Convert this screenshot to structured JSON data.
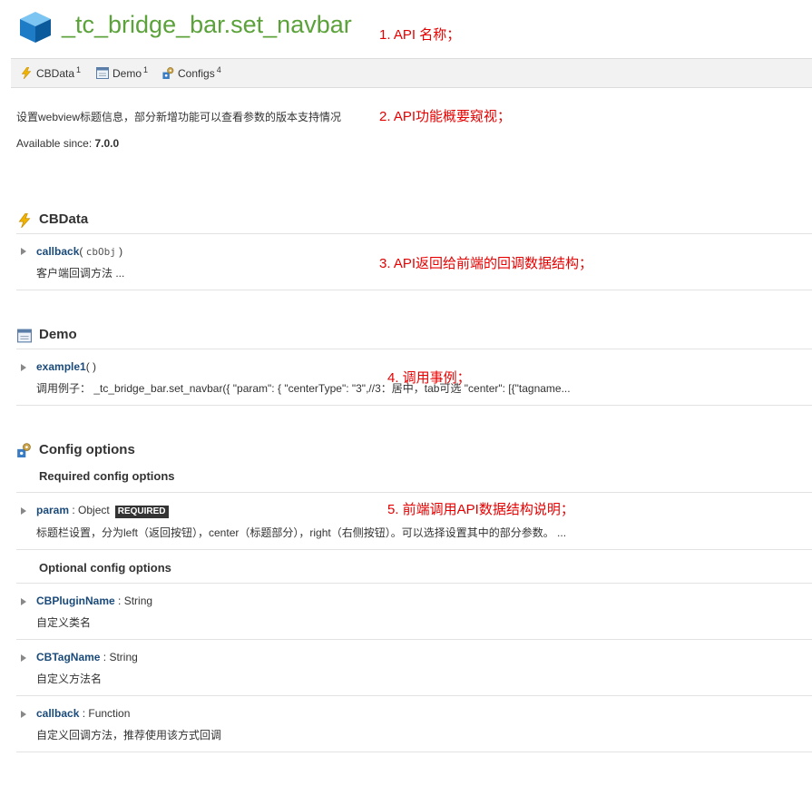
{
  "page": {
    "title": "_tc_bridge_bar.set_navbar",
    "description": "设置webview标题信息，部分新增功能可以查看参数的版本支持情况",
    "available_label": "Available since: ",
    "available_version": "7.0.0"
  },
  "toolbar": {
    "items": [
      {
        "label": "CBData",
        "count": "1",
        "icon": "lightning-icon"
      },
      {
        "label": "Demo",
        "count": "1",
        "icon": "window-icon"
      },
      {
        "label": "Configs",
        "count": "4",
        "icon": "gears-icon"
      }
    ]
  },
  "annotations": [
    "1. API 名称；",
    "2. API功能概要窥视；",
    "3. API返回给前端的回调数据结构；",
    "4. 调用事例；",
    "5. 前端调用API数据结构说明；"
  ],
  "sections": {
    "cbdata": {
      "title": "CBData",
      "member": {
        "name": "callback",
        "open": "( ",
        "param": "cbObj",
        "close": " )",
        "desc": "客户端回调方法 ..."
      }
    },
    "demo": {
      "title": "Demo",
      "member": {
        "name": "example1",
        "sig": "( )",
        "desc": "调用例子： _tc_bridge_bar.set_navbar({ \"param\": { \"centerType\": \"3\",//3：居中，tab可选 \"center\": [{\"tagname..."
      }
    },
    "config": {
      "title": "Config options",
      "required_head": "Required config options",
      "required": [
        {
          "name": "param",
          "type": " : Object",
          "badge": "REQUIRED",
          "desc": "标题栏设置，分为left（返回按钮），center（标题部分），right（右侧按钮）。可以选择设置其中的部分参数。 ..."
        }
      ],
      "optional_head": "Optional config options",
      "optional": [
        {
          "name": "CBPluginName",
          "type": " : String",
          "desc": "自定义类名"
        },
        {
          "name": "CBTagName",
          "type": " : String",
          "desc": "自定义方法名"
        },
        {
          "name": "callback",
          "type": " : Function",
          "desc": "自定义回调方法，推荐使用该方式回调"
        }
      ]
    }
  },
  "colors": {
    "title": "#5ba23a",
    "annotation": "#e60000",
    "link": "#1a4a7a"
  }
}
